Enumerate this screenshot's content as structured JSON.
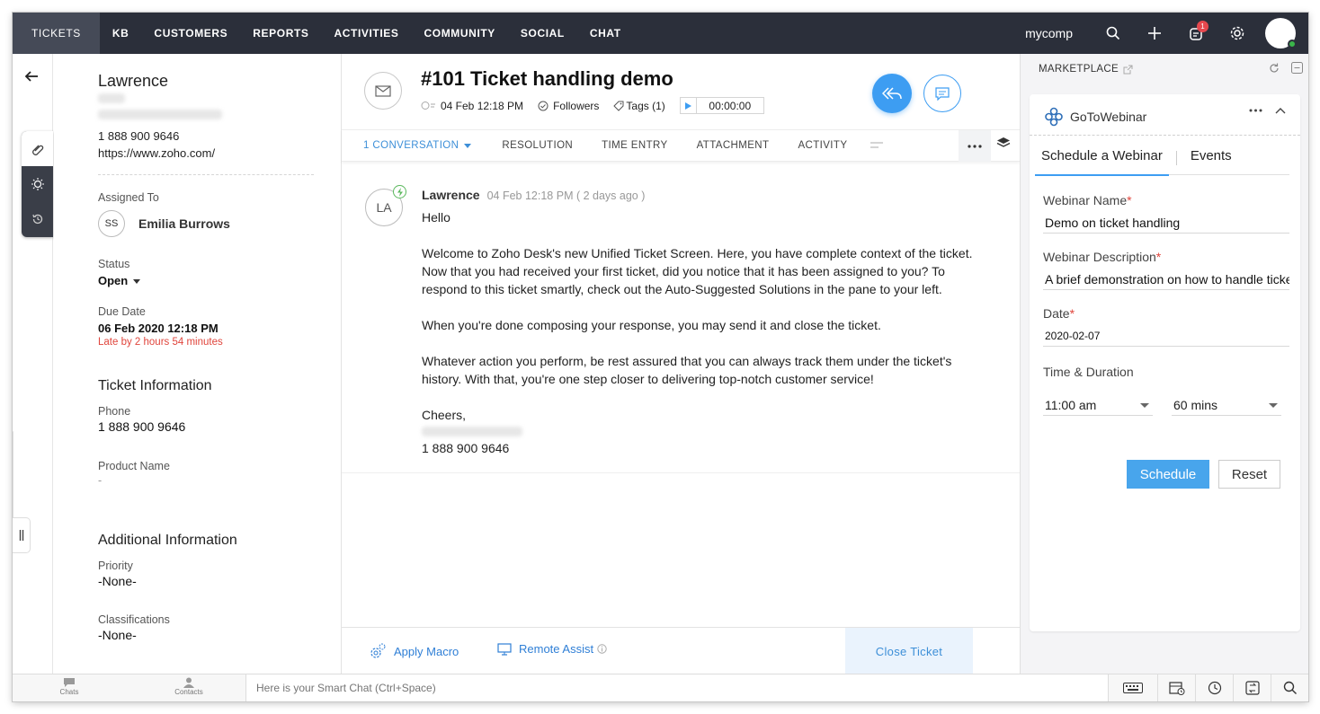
{
  "nav": {
    "items": [
      "TICKETS",
      "KB",
      "CUSTOMERS",
      "REPORTS",
      "ACTIVITIES",
      "COMMUNITY",
      "SOCIAL",
      "CHAT"
    ],
    "org_name": "mycomp",
    "notification_count": "1"
  },
  "contact": {
    "name": "Lawrence",
    "phone": "1 888 900 9646",
    "website": "https://www.zoho.com/",
    "assigned_label": "Assigned To",
    "assignee_initials": "SS",
    "assignee_name": "Emilia Burrows",
    "status_label": "Status",
    "status_value": "Open",
    "due_label": "Due Date",
    "due_value": "06 Feb 2020 12:18 PM",
    "late_text": "Late by 2 hours 54 minutes",
    "ticket_info_title": "Ticket Information",
    "phone_label": "Phone",
    "phone_value": "1 888 900 9646",
    "product_label": "Product Name",
    "product_value": "-",
    "additional_title": "Additional Information",
    "priority_label": "Priority",
    "priority_value": "-None-",
    "class_label": "Classifications",
    "class_value": "-None-"
  },
  "ticket": {
    "title": "#101  Ticket handling demo",
    "date": "04 Feb 12:18 PM",
    "followers": "Followers",
    "tags": "Tags (1)",
    "timer": "00:00:00",
    "tabs": [
      "1 CONVERSATION",
      "RESOLUTION",
      "TIME ENTRY",
      "ATTACHMENT",
      "ACTIVITY"
    ],
    "message": {
      "avatar": "LA",
      "sender": "Lawrence",
      "time": "04 Feb 12:18 PM ( 2 days ago )",
      "greeting": "Hello",
      "p1": "Welcome to Zoho Desk's new Unified Ticket Screen. Here, you have complete context of the ticket. Now that you had received your first ticket, did you notice that it has been assigned to you? To respond to this ticket smartly, check out the Auto-Suggested Solutions in the pane to your left.",
      "p2": "When you're done composing your response, you may send it and close the ticket.",
      "p3": "Whatever action you perform, be rest assured that you can always track them under the ticket's history. With that, you're one step closer to delivering top-notch customer service!",
      "signoff": "Cheers,",
      "sig_phone": "1 888 900 9646"
    },
    "apply_macro": "Apply Macro",
    "remote_assist": "Remote Assist",
    "close_ticket": "Close Ticket"
  },
  "marketplace": {
    "title": "MARKETPLACE",
    "widget_name": "GoToWebinar",
    "tabs": [
      "Schedule a Webinar",
      "Events"
    ],
    "name_label": "Webinar Name",
    "name_value": "Demo on ticket handling",
    "desc_label": "Webinar Description",
    "desc_value": "A brief demonstration on how to handle tickets",
    "date_label": "Date",
    "date_value": "2020-02-07",
    "time_label": "Time & Duration",
    "time_value": "11:00 am",
    "duration_value": "60 mins",
    "schedule_btn": "Schedule",
    "reset_btn": "Reset"
  },
  "footer": {
    "chats": "Chats",
    "contacts": "Contacts",
    "smart_chat_placeholder": "Here is your Smart Chat (Ctrl+Space)"
  },
  "colors": {
    "nav_bg": "#2b2f3a",
    "accent": "#3d9df2",
    "late": "#e0453c"
  }
}
